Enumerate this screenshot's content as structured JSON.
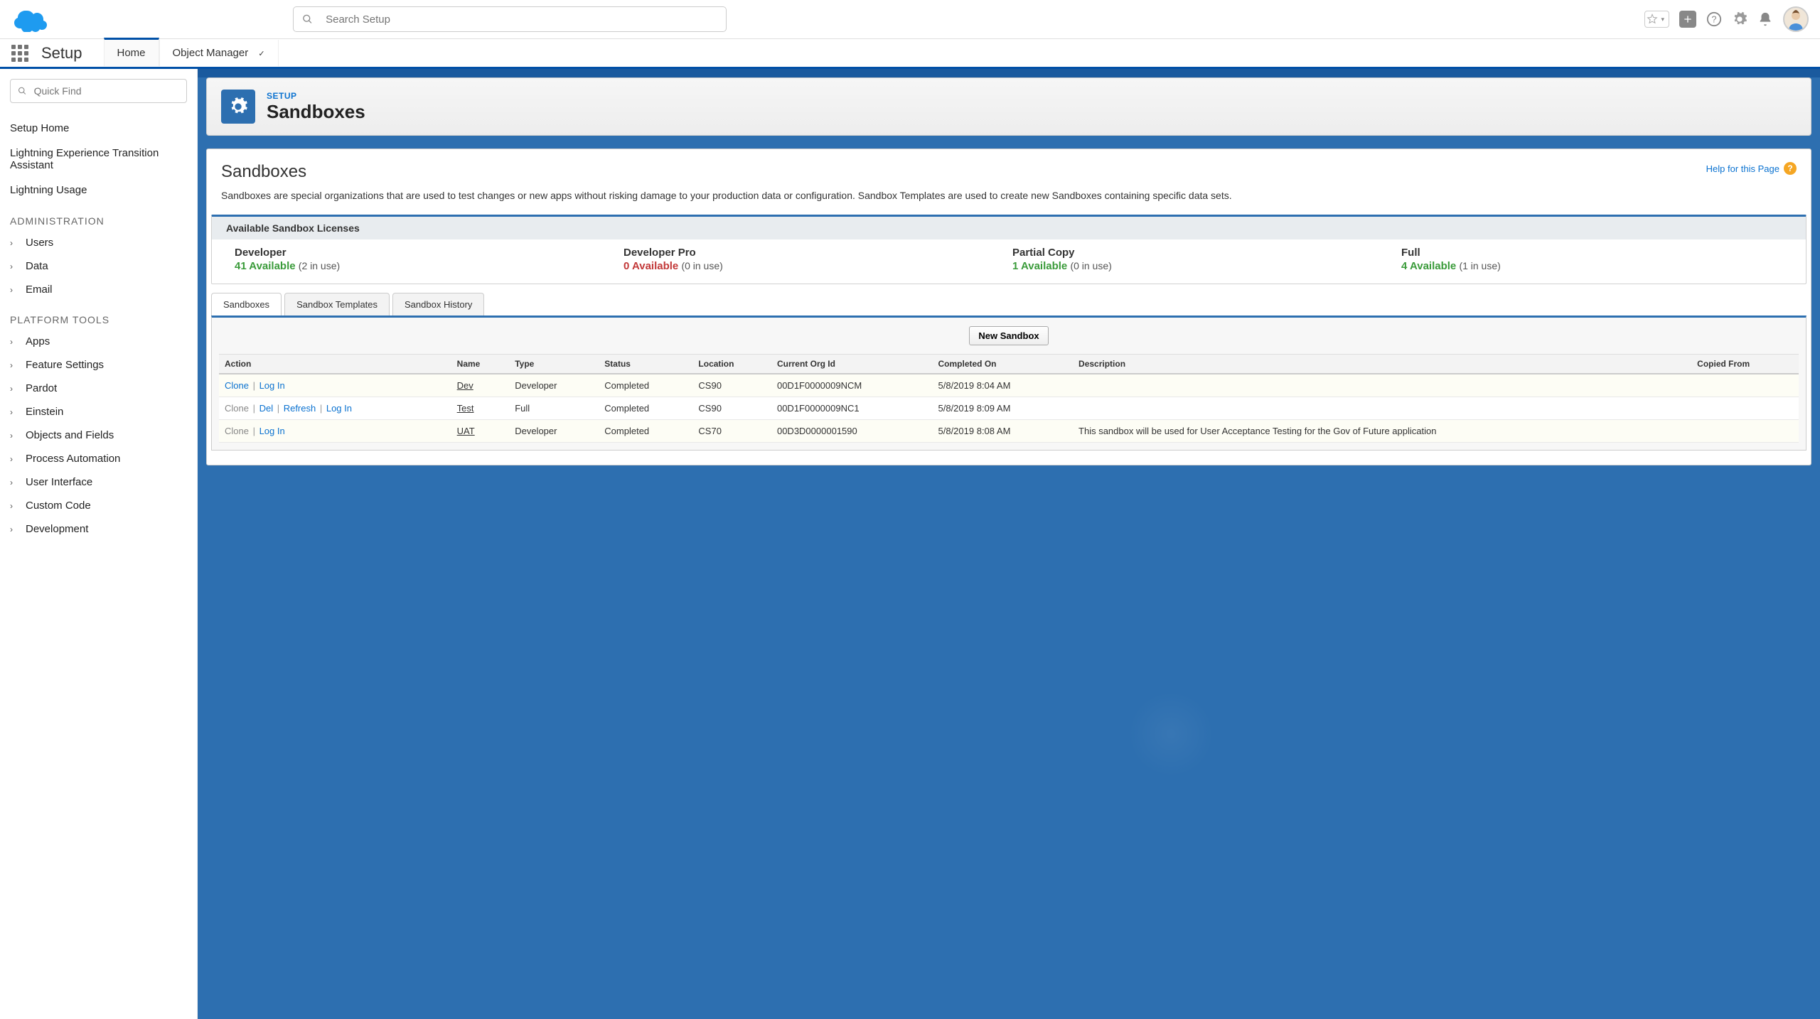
{
  "header": {
    "search_placeholder": "Search Setup"
  },
  "nav": {
    "app_title": "Setup",
    "tabs": [
      {
        "label": "Home",
        "active": true
      },
      {
        "label": "Object Manager",
        "active": false
      }
    ]
  },
  "sidebar": {
    "quickfind_placeholder": "Quick Find",
    "top_links": [
      "Setup Home",
      "Lightning Experience Transition Assistant",
      "Lightning Usage"
    ],
    "sections": [
      {
        "title": "ADMINISTRATION",
        "items": [
          "Users",
          "Data",
          "Email"
        ]
      },
      {
        "title": "PLATFORM TOOLS",
        "items": [
          "Apps",
          "Feature Settings",
          "Pardot",
          "Einstein",
          "Objects and Fields",
          "Process Automation",
          "User Interface",
          "Custom Code",
          "Development"
        ]
      }
    ]
  },
  "page": {
    "crumb": "SETUP",
    "title": "Sandboxes",
    "heading": "Sandboxes",
    "help_label": "Help for this Page",
    "description": "Sandboxes are special organizations that are used to test changes or new apps without risking damage to your production data or configuration. Sandbox Templates are used to create new Sandboxes containing specific data sets.",
    "licenses_title": "Available Sandbox Licenses",
    "licenses": [
      {
        "name": "Developer",
        "available": "41 Available",
        "inuse": "(2 in use)",
        "style": "green"
      },
      {
        "name": "Developer Pro",
        "available": "0 Available",
        "inuse": "(0 in use)",
        "style": "red"
      },
      {
        "name": "Partial Copy",
        "available": "1 Available",
        "inuse": "(0 in use)",
        "style": "green"
      },
      {
        "name": "Full",
        "available": "4 Available",
        "inuse": "(1 in use)",
        "style": "green"
      }
    ],
    "subtabs": [
      "Sandboxes",
      "Sandbox Templates",
      "Sandbox History"
    ],
    "new_button": "New Sandbox",
    "columns": [
      "Action",
      "Name",
      "Type",
      "Status",
      "Location",
      "Current Org Id",
      "Completed On",
      "Description",
      "Copied From"
    ],
    "rows": [
      {
        "actions": [
          {
            "label": "Clone",
            "style": "link"
          },
          {
            "label": "Log In",
            "style": "link"
          }
        ],
        "name": "Dev",
        "type": "Developer",
        "status": "Completed",
        "location": "CS90",
        "orgid": "00D1F0000009NCM",
        "completed": "5/8/2019 8:04 AM",
        "description": "",
        "copied": ""
      },
      {
        "actions": [
          {
            "label": "Clone",
            "style": "muted"
          },
          {
            "label": "Del",
            "style": "link"
          },
          {
            "label": "Refresh",
            "style": "link"
          },
          {
            "label": "Log In",
            "style": "link"
          }
        ],
        "name": "Test",
        "type": "Full",
        "status": "Completed",
        "location": "CS90",
        "orgid": "00D1F0000009NC1",
        "completed": "5/8/2019 8:09 AM",
        "description": "",
        "copied": ""
      },
      {
        "actions": [
          {
            "label": "Clone",
            "style": "muted"
          },
          {
            "label": "Log In",
            "style": "link"
          }
        ],
        "name": "UAT",
        "type": "Developer",
        "status": "Completed",
        "location": "CS70",
        "orgid": "00D3D0000001590",
        "completed": "5/8/2019 8:08 AM",
        "description": "This sandbox will be used for User Acceptance Testing for the Gov of Future application",
        "copied": ""
      }
    ]
  }
}
